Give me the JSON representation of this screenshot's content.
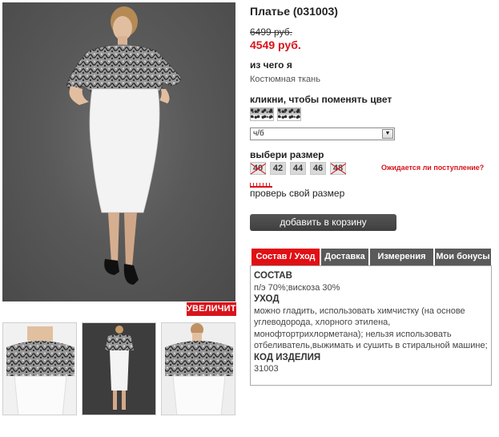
{
  "product": {
    "title": "Платье (031003)",
    "old_price": "6499 руб.",
    "new_price": "4549 руб."
  },
  "material": {
    "label": "из чего я",
    "value": "Костюмная ткань"
  },
  "color": {
    "label": "кликни, чтобы поменять цвет",
    "selected": "ч/б",
    "swatches": [
      "print-black-white",
      "print-black-white"
    ]
  },
  "size": {
    "label": "выбери размер",
    "options": [
      {
        "value": "40",
        "available": false
      },
      {
        "value": "42",
        "available": true
      },
      {
        "value": "44",
        "available": true
      },
      {
        "value": "46",
        "available": true
      },
      {
        "value": "48",
        "available": false
      }
    ],
    "await_link": "Ожидается ли поступление?",
    "check_link": "проверь свой размер"
  },
  "gallery": {
    "zoom_label": "УВЕЛИЧИТЬ"
  },
  "cart": {
    "button_label": "добавить в корзину"
  },
  "tabs": [
    {
      "label": "Состав / Уход",
      "active": true
    },
    {
      "label": "Доставка",
      "active": false
    },
    {
      "label": "Измерения",
      "active": false
    },
    {
      "label": "Мои бонусы",
      "active": false
    }
  ],
  "tab_content": {
    "composition_title": "СОСТАВ",
    "composition_text": "п/э 70%;вискоза 30%",
    "care_title": "УХОД",
    "care_text": "можно гладить, использовать химчистку (на основе углеводорода, хлорного этилена, монофтортрихлорметана); нельзя использовать отбеливатель,выжимать и сушить в стиральной машине;",
    "code_title": "КОД ИЗДЕЛИЯ",
    "code_text": "31003"
  },
  "colors": {
    "accent_red": "#d8141b",
    "dark_button": "#4a4a4a",
    "tab_gray": "#5a5a5a"
  }
}
